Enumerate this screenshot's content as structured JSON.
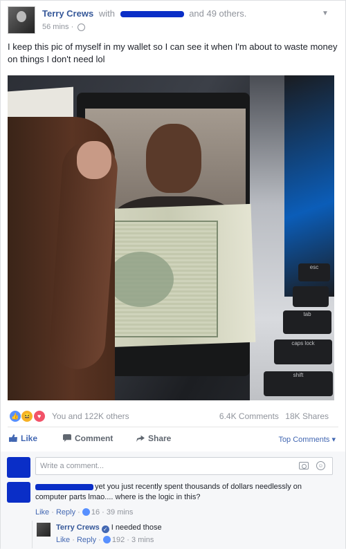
{
  "post": {
    "author": "Terry Crews",
    "with_text": "with",
    "others_text": "and 49 others.",
    "time": "56 mins",
    "separator": "·",
    "body": "I keep this pic of myself in my wallet so I can see it when I'm about to waste money on things I don't need lol",
    "photo_keys": {
      "esc": "esc",
      "tab": "tab",
      "caps": "caps lock",
      "shift": "shift"
    }
  },
  "engagement": {
    "reactions_text": "You and 122K others",
    "comments_count": "6.4K Comments",
    "shares_count": "18K Shares"
  },
  "actions": {
    "like": "Like",
    "comment": "Comment",
    "share": "Share",
    "top_comments": "Top Comments ▾"
  },
  "composer": {
    "placeholder": "Write a comment..."
  },
  "comments": [
    {
      "text": "yet you just recently spent thousands of dollars needlessly on computer parts lmao.... where is the logic in this?",
      "like_label": "Like",
      "reply_label": "Reply",
      "like_count": "16",
      "time": "39 mins"
    }
  ],
  "reply": {
    "author": "Terry Crews",
    "text": "I needed those",
    "like_label": "Like",
    "reply_label": "Reply",
    "like_count": "192",
    "time": "3 mins"
  },
  "colors": {
    "link_blue": "#365899",
    "action_blue": "#4267b2",
    "redaction_blue": "#0a2ec7",
    "meta_gray": "#90949c"
  }
}
